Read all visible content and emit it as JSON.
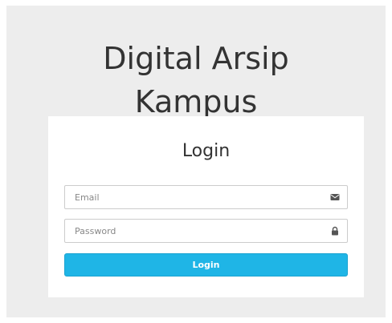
{
  "app": {
    "title_line1": "Digital Arsip",
    "title_line2": "Kampus"
  },
  "login": {
    "heading": "Login",
    "email": {
      "placeholder": "Email",
      "value": "",
      "icon": "envelope-icon"
    },
    "password": {
      "placeholder": "Password",
      "value": "",
      "icon": "lock-icon"
    },
    "submit_label": "Login"
  },
  "colors": {
    "page_background": "#ededed",
    "card_background": "#ffffff",
    "button_background": "#1fb5e6",
    "button_text": "#ffffff",
    "title_text": "#333333",
    "icon": "#555555"
  }
}
